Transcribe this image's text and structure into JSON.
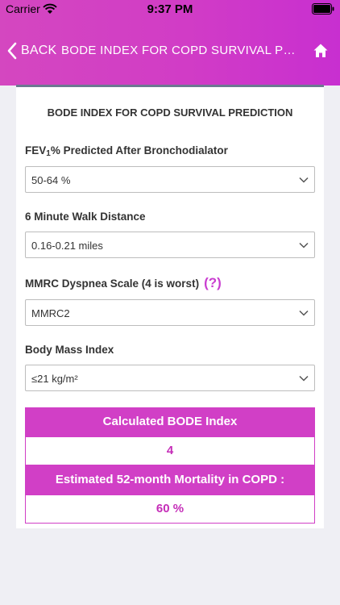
{
  "status_bar": {
    "carrier": "Carrier",
    "time": "9:37 PM"
  },
  "nav": {
    "back_label": "BACK",
    "title": "BODE INDEX FOR COPD SURVIVAL PREDICTION"
  },
  "form": {
    "title": "BODE INDEX FOR COPD SURVIVAL PREDICTION",
    "fev": {
      "label_prefix": "FEV",
      "label_sub": "1",
      "label_suffix": "% Predicted After Bronchodialator",
      "value": "50-64 %"
    },
    "walk": {
      "label": "6 Minute Walk Distance",
      "value": "0.16-0.21 miles"
    },
    "mmrc": {
      "label": "MMRC Dyspnea Scale (4 is worst)",
      "help": "(?)",
      "value": "MMRC2"
    },
    "bmi": {
      "label": "Body Mass Index",
      "value": "≤21 kg/m²"
    }
  },
  "results": {
    "bode_label": "Calculated BODE Index",
    "bode_value": "4",
    "mortality_label": "Estimated 52-month Mortality in COPD :",
    "mortality_value": "60 %"
  },
  "colors": {
    "accent": "#d13fc6",
    "nav_gradient_start": "#d447c0",
    "card_rule": "#6c7891"
  },
  "icons": {
    "back": "chevron-left-icon",
    "home": "home-icon",
    "select_arrow": "chevron-down-icon"
  }
}
